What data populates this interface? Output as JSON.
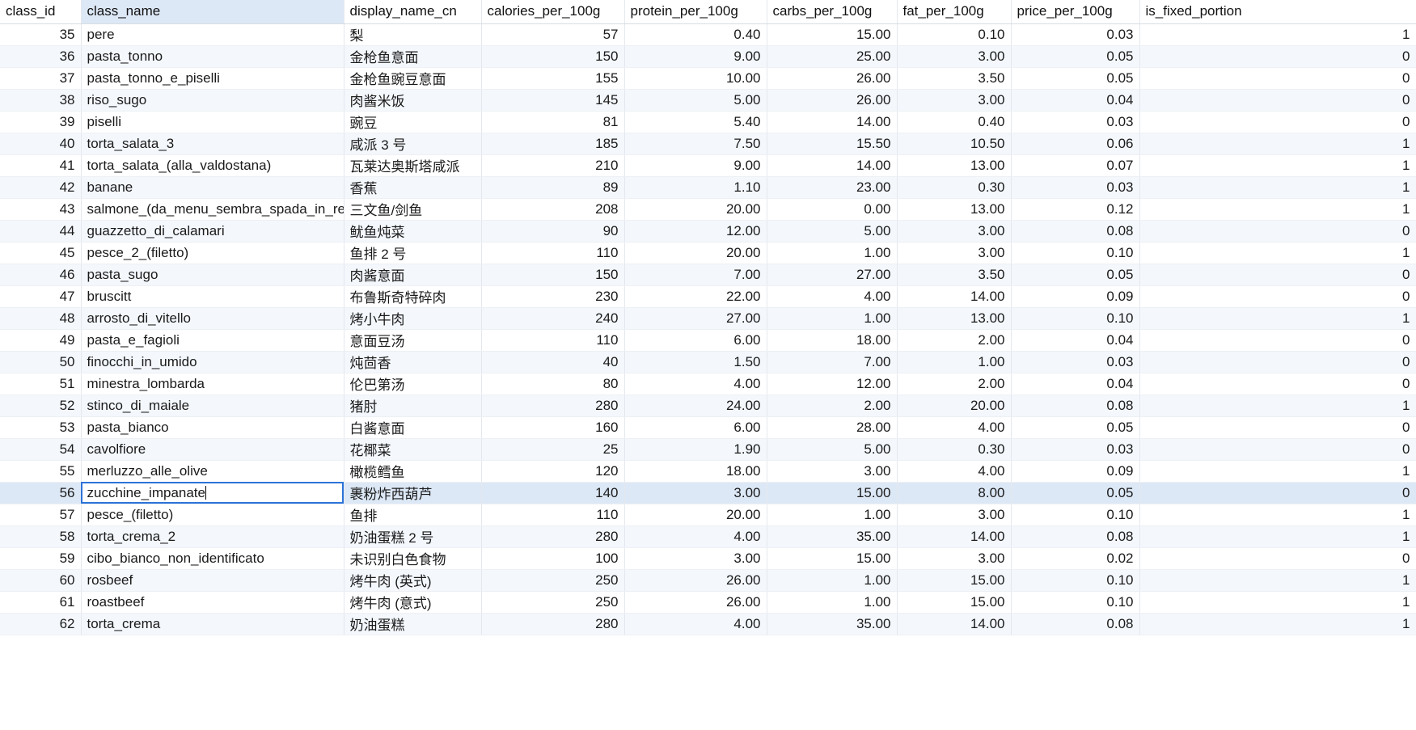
{
  "table": {
    "columns": [
      "class_id",
      "class_name",
      "display_name_cn",
      "calories_per_100g",
      "protein_per_100g",
      "carbs_per_100g",
      "fat_per_100g",
      "price_per_100g",
      "is_fixed_portion"
    ],
    "rows": [
      [
        "35",
        "pere",
        "梨",
        "57",
        "0.40",
        "15.00",
        "0.10",
        "0.03",
        "1"
      ],
      [
        "36",
        "pasta_tonno",
        "金枪鱼意面",
        "150",
        "9.00",
        "25.00",
        "3.00",
        "0.05",
        "0"
      ],
      [
        "37",
        "pasta_tonno_e_piselli",
        "金枪鱼豌豆意面",
        "155",
        "10.00",
        "26.00",
        "3.50",
        "0.05",
        "0"
      ],
      [
        "38",
        "riso_sugo",
        "肉酱米饭",
        "145",
        "5.00",
        "26.00",
        "3.00",
        "0.04",
        "0"
      ],
      [
        "39",
        "piselli",
        "豌豆",
        "81",
        "5.40",
        "14.00",
        "0.40",
        "0.03",
        "0"
      ],
      [
        "40",
        "torta_salata_3",
        "咸派 3 号",
        "185",
        "7.50",
        "15.50",
        "10.50",
        "0.06",
        "1"
      ],
      [
        "41",
        "torta_salata_(alla_valdostana)",
        "瓦莱达奥斯塔咸派",
        "210",
        "9.00",
        "14.00",
        "13.00",
        "0.07",
        "1"
      ],
      [
        "42",
        "banane",
        "香蕉",
        "89",
        "1.10",
        "23.00",
        "0.30",
        "0.03",
        "1"
      ],
      [
        "43",
        "salmone_(da_menu_sembra_spada_in_re",
        "三文鱼/剑鱼",
        "208",
        "20.00",
        "0.00",
        "13.00",
        "0.12",
        "1"
      ],
      [
        "44",
        "guazzetto_di_calamari",
        "鱿鱼炖菜",
        "90",
        "12.00",
        "5.00",
        "3.00",
        "0.08",
        "0"
      ],
      [
        "45",
        "pesce_2_(filetto)",
        "鱼排 2 号",
        "110",
        "20.00",
        "1.00",
        "3.00",
        "0.10",
        "1"
      ],
      [
        "46",
        "pasta_sugo",
        "肉酱意面",
        "150",
        "7.00",
        "27.00",
        "3.50",
        "0.05",
        "0"
      ],
      [
        "47",
        "bruscitt",
        "布鲁斯奇特碎肉",
        "230",
        "22.00",
        "4.00",
        "14.00",
        "0.09",
        "0"
      ],
      [
        "48",
        "arrosto_di_vitello",
        "烤小牛肉",
        "240",
        "27.00",
        "1.00",
        "13.00",
        "0.10",
        "1"
      ],
      [
        "49",
        "pasta_e_fagioli",
        "意面豆汤",
        "110",
        "6.00",
        "18.00",
        "2.00",
        "0.04",
        "0"
      ],
      [
        "50",
        "finocchi_in_umido",
        "炖茴香",
        "40",
        "1.50",
        "7.00",
        "1.00",
        "0.03",
        "0"
      ],
      [
        "51",
        "minestra_lombarda",
        "伦巴第汤",
        "80",
        "4.00",
        "12.00",
        "2.00",
        "0.04",
        "0"
      ],
      [
        "52",
        "stinco_di_maiale",
        "猪肘",
        "280",
        "24.00",
        "2.00",
        "20.00",
        "0.08",
        "1"
      ],
      [
        "53",
        "pasta_bianco",
        "白酱意面",
        "160",
        "6.00",
        "28.00",
        "4.00",
        "0.05",
        "0"
      ],
      [
        "54",
        "cavolfiore",
        "花椰菜",
        "25",
        "1.90",
        "5.00",
        "0.30",
        "0.03",
        "0"
      ],
      [
        "55",
        "merluzzo_alle_olive",
        "橄榄鳕鱼",
        "120",
        "18.00",
        "3.00",
        "4.00",
        "0.09",
        "1"
      ],
      [
        "56",
        "zucchine_impanate",
        "裹粉炸西葫芦",
        "140",
        "3.00",
        "15.00",
        "8.00",
        "0.05",
        "0"
      ],
      [
        "57",
        "pesce_(filetto)",
        "鱼排",
        "110",
        "20.00",
        "1.00",
        "3.00",
        "0.10",
        "1"
      ],
      [
        "58",
        "torta_crema_2",
        "奶油蛋糕 2 号",
        "280",
        "4.00",
        "35.00",
        "14.00",
        "0.08",
        "1"
      ],
      [
        "59",
        "cibo_bianco_non_identificato",
        "未识别白色食物",
        "100",
        "3.00",
        "15.00",
        "3.00",
        "0.02",
        "0"
      ],
      [
        "60",
        "rosbeef",
        "烤牛肉 (英式)",
        "250",
        "26.00",
        "1.00",
        "15.00",
        "0.10",
        "1"
      ],
      [
        "61",
        "roastbeef",
        "烤牛肉 (意式)",
        "250",
        "26.00",
        "1.00",
        "15.00",
        "0.10",
        "1"
      ],
      [
        "62",
        "torta_crema",
        "奶油蛋糕",
        "280",
        "4.00",
        "35.00",
        "14.00",
        "0.08",
        "1"
      ]
    ],
    "selected_row_index": 21,
    "editing_column_index": 1,
    "selected_column_index": 1
  },
  "colors": {
    "selection": "#dde8f6",
    "row_alt": "#f4f8fd",
    "edit_border": "#2d73d8"
  }
}
